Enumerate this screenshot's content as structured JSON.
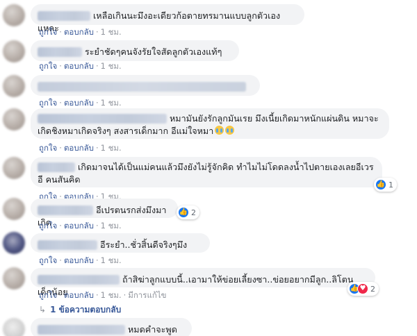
{
  "actions": {
    "like": "ถูกใจ",
    "reply": "ตอบกลับ",
    "separator": "·"
  },
  "comments": [
    {
      "text": "เหลือเกินนะมึงอะเดียวก้อตายทรมานแบบลูกตัวเองแหละ",
      "time": "1 ชม."
    },
    {
      "text": "ระยำชัดๆคนจังรัยใจสัดลูกตัวเองแท้ๆ",
      "time": "1 ชม."
    },
    {
      "text": "",
      "time": "1 ชม."
    },
    {
      "text": "หมามันยังรักลูกมันเรย มึงเนี้ยเกิดมาหนักแผ่นดิน หมาจะ เกิดชิงหมาเกิดจริงๆ สงสารเด็กมาก อีแม่ใจหมา",
      "time": "1 ชม."
    },
    {
      "text": "เกิดมาจนได้เป็นแม่คนแล้วมึงยังไม่รู้จักคิด ทำไมไม่โดดลงน้ำไปตายเองเลยอีเวร อี คนสันคิด",
      "time": "1 ชม.",
      "reactions": "1"
    },
    {
      "text": "อีเปรตนรกส่งมึงมาเกิด",
      "time": "1 ชม.",
      "reactions": "2"
    },
    {
      "text": "อีระยำ..ชั่วสิ้นดีจริงๆมึง",
      "time": "1 ชม."
    },
    {
      "text": "ถ้าสิฆ่าลูกแบบนี้..เอามาให้ข่อยเลี้ยงซา..ข่อยอยากมีลูก..ลิโตนเด็กน้อย",
      "time": "1 ชม.",
      "edited": "มีการแก้ไข",
      "reactions": "2"
    },
    {
      "text": "หมดคำจะพูด"
    }
  ],
  "reply_summary": "1 ข้อความตอบกลับ",
  "colors": {
    "bubble": "#f2f3f5",
    "link": "#385898",
    "meta": "#90949c",
    "like": "#1877f2",
    "love": "#f0284a"
  }
}
